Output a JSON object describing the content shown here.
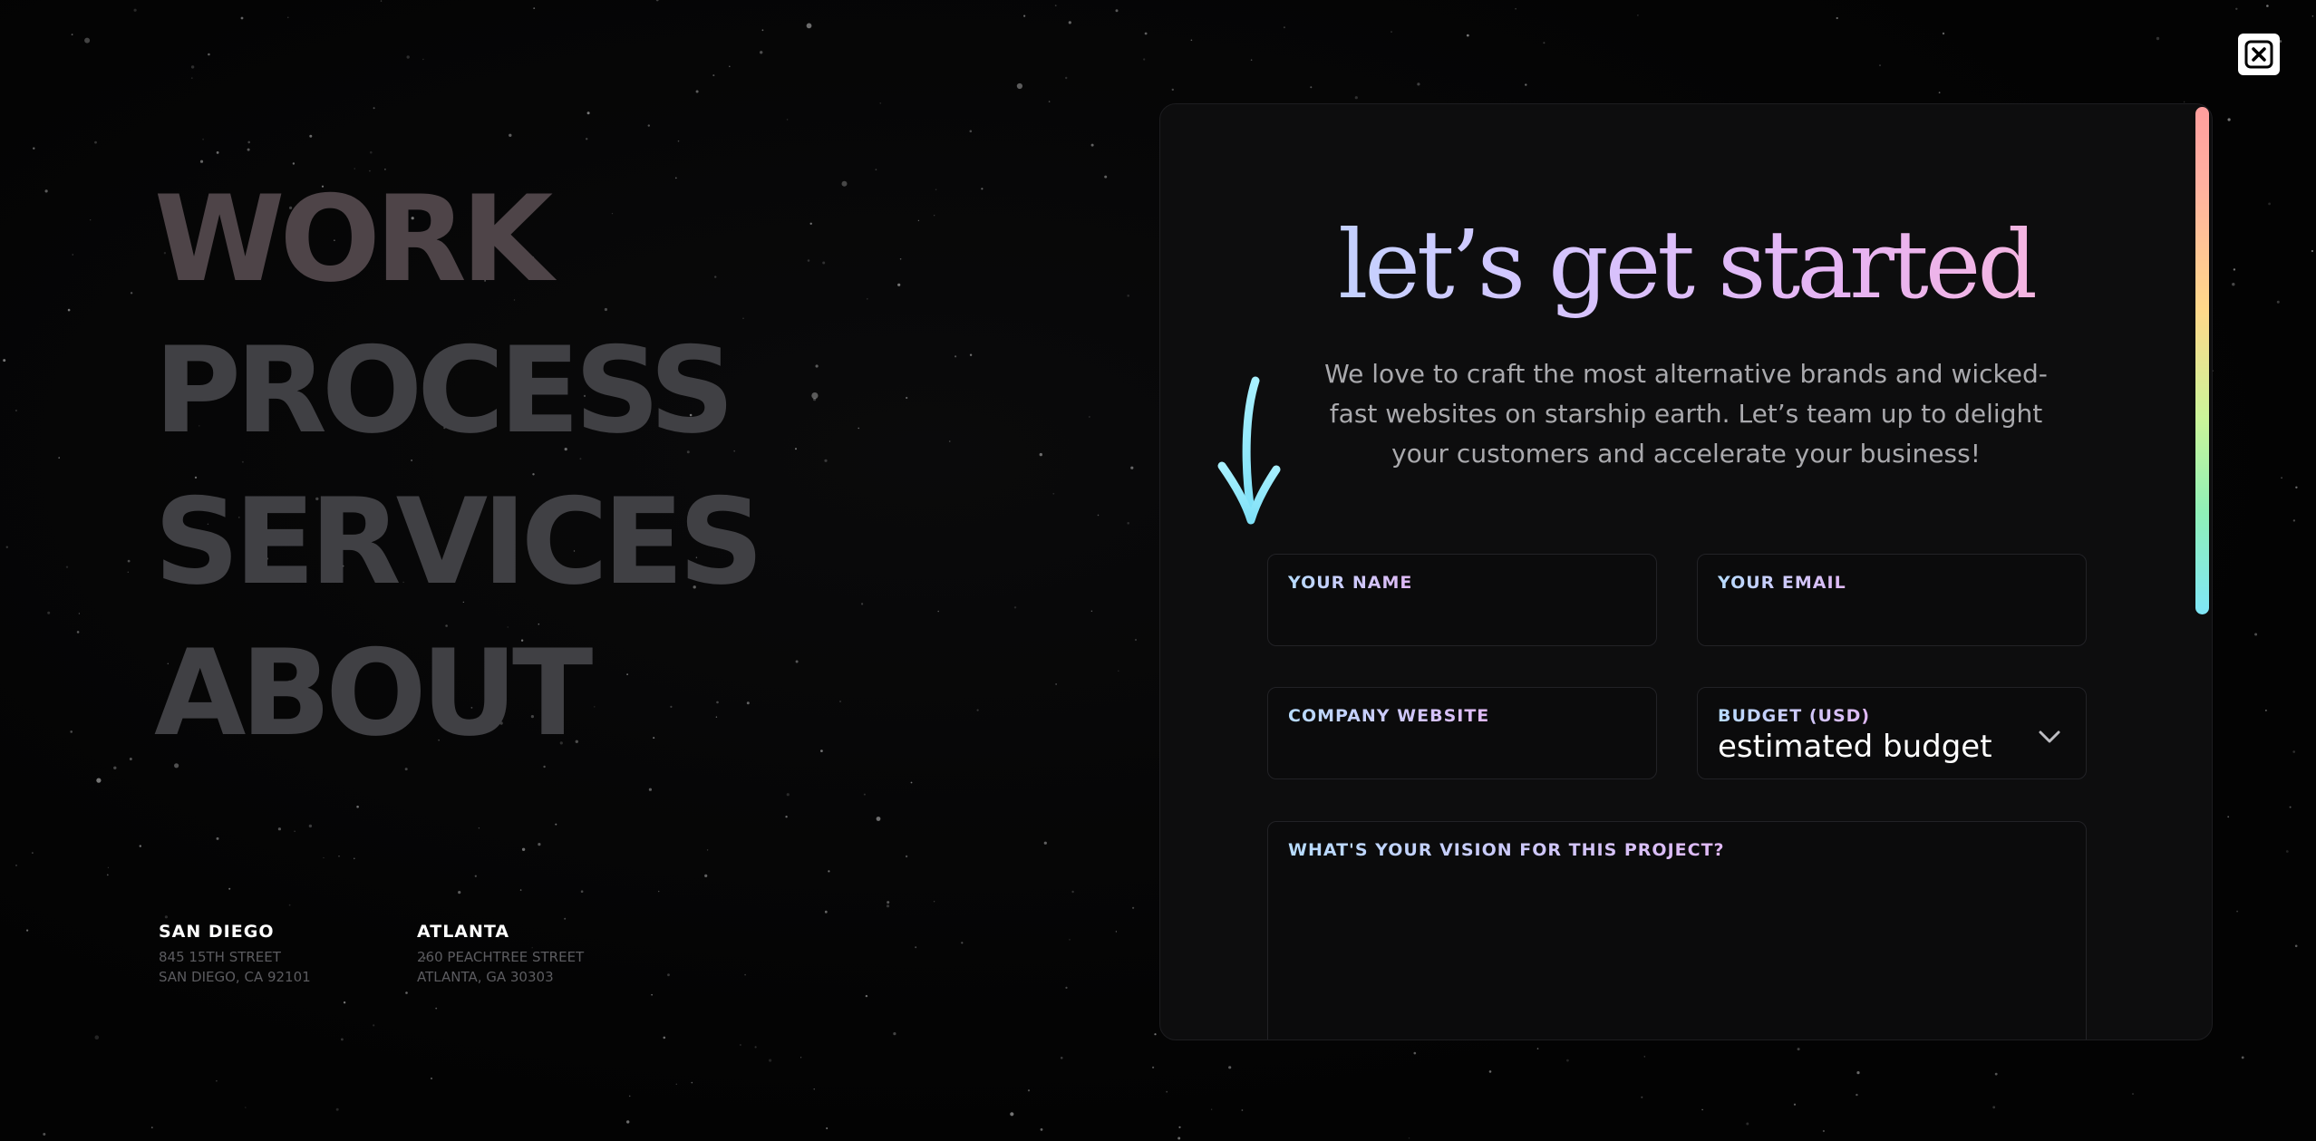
{
  "nav": {
    "items": [
      {
        "label": "WORK"
      },
      {
        "label": "PROCESS"
      },
      {
        "label": "SERVICES"
      },
      {
        "label": "ABOUT"
      }
    ]
  },
  "locations": [
    {
      "city": "SAN DIEGO",
      "street": "845 15TH STREET",
      "region": "SAN DIEGO, CA 92101"
    },
    {
      "city": "ATLANTA",
      "street": "260 PEACHTREE STREET",
      "region": "ATLANTA, GA 30303"
    }
  ],
  "modal": {
    "close_icon": "close-icon",
    "heading": "let’s get started",
    "intro": "We love to craft the most alternative brands and wicked-fast websites on starship earth. Let’s team up to delight your customers and accelerate your business!",
    "arrow_icon": "arrow-down-icon",
    "accent_gradient": [
      "#b6dcff",
      "#d3c6ff",
      "#e7b4f3",
      "#ffb6cf"
    ],
    "scrollbar_gradient": [
      "#ff9e9e",
      "#ffd88a",
      "#c9f59a",
      "#7fe6f7"
    ],
    "form": {
      "name_label": "YOUR NAME",
      "name_value": "",
      "email_label": "YOUR EMAIL",
      "email_value": "",
      "website_label": "COMPANY WEBSITE",
      "website_value": "",
      "budget_label": "BUDGET (USD)",
      "budget_value": "estimated budget",
      "vision_label": "WHAT'S YOUR VISION FOR THIS PROJECT?",
      "vision_value": ""
    }
  }
}
